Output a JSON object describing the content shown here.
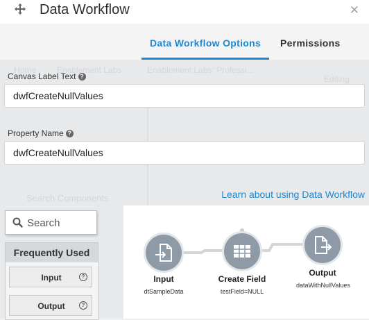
{
  "header": {
    "title": "Data Workflow"
  },
  "tabs": [
    {
      "label": "Data Workflow Options",
      "active": true
    },
    {
      "label": "Permissions",
      "active": false
    }
  ],
  "fields": {
    "canvas_label": {
      "label": "Canvas Label Text",
      "value": "dwfCreateNullValues"
    },
    "property_name": {
      "label": "Property Name",
      "value": "dwfCreateNullValues"
    }
  },
  "learn_link": "Learn about using Data Workflow",
  "palette": {
    "search_placeholder": "Search",
    "section_title": "Frequently Used",
    "items": [
      {
        "label": "Input"
      },
      {
        "label": "Output"
      }
    ]
  },
  "workflow": {
    "nodes": [
      {
        "title": "Input",
        "subtitle": "dtSampleData",
        "icon": "import-document-icon"
      },
      {
        "title": "Create Field",
        "subtitle": "testField=NULL",
        "icon": "table-grid-icon"
      },
      {
        "title": "Output",
        "subtitle": "dataWithNullValues",
        "icon": "export-document-icon"
      }
    ]
  },
  "background_ghost": {
    "breadcrumb_1": "Home",
    "breadcrumb_2": "Enablement Labs",
    "breadcrumb_3": "Enablement Labs: Professi...",
    "editing": "Editing",
    "search_components": "Search Components"
  },
  "colors": {
    "accent": "#1f88cf",
    "node_fill": "#8e9aa5"
  }
}
